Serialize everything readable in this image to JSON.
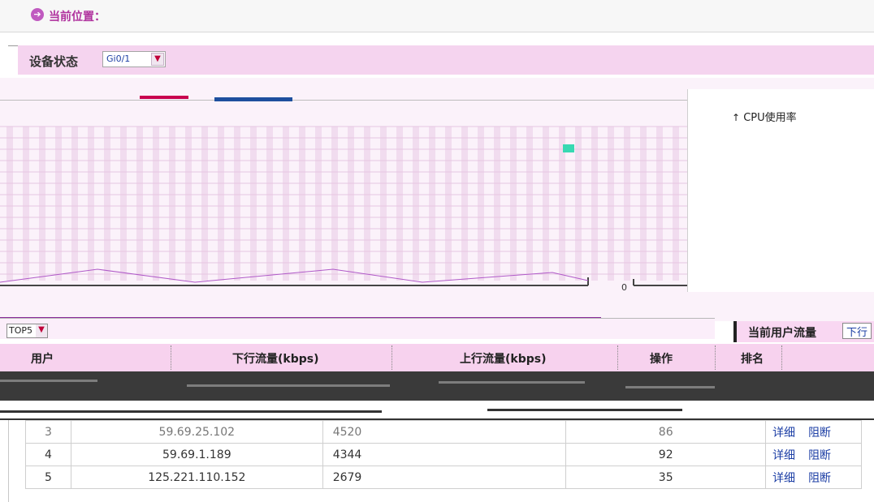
{
  "breadcrumb": {
    "label": "当前位置："
  },
  "status": {
    "title": "设备状态",
    "port": "Gi0/1"
  },
  "cpu_chart": {
    "title": "CPU使用率",
    "zero_tick": "0"
  },
  "top_filter": {
    "value": "TOP5"
  },
  "current_flow": {
    "label": "当前用户流量",
    "select_value": "下行"
  },
  "table": {
    "headers": {
      "user": "用户",
      "down": "下行流量(kbps)",
      "up": "上行流量(kbps)",
      "action": "操作",
      "rank": "排名"
    },
    "rows": [
      {
        "rank": "3",
        "user": "59.69.25.102",
        "down": "4520",
        "up": "86",
        "detail": "详细",
        "block": "阻断"
      },
      {
        "rank": "4",
        "user": "59.69.1.189",
        "down": "4344",
        "up": "92",
        "detail": "详细",
        "block": "阻断"
      },
      {
        "rank": "5",
        "user": "125.221.110.152",
        "down": "2679",
        "up": "35",
        "detail": "详细",
        "block": "阻断"
      }
    ]
  },
  "colors": {
    "accent": "#b0339e",
    "header_pink": "#f7d2ee",
    "link": "#1d3fa5"
  },
  "icons": {
    "breadcrumb": "arrow-circle-icon",
    "select": "chevron-down-icon"
  }
}
